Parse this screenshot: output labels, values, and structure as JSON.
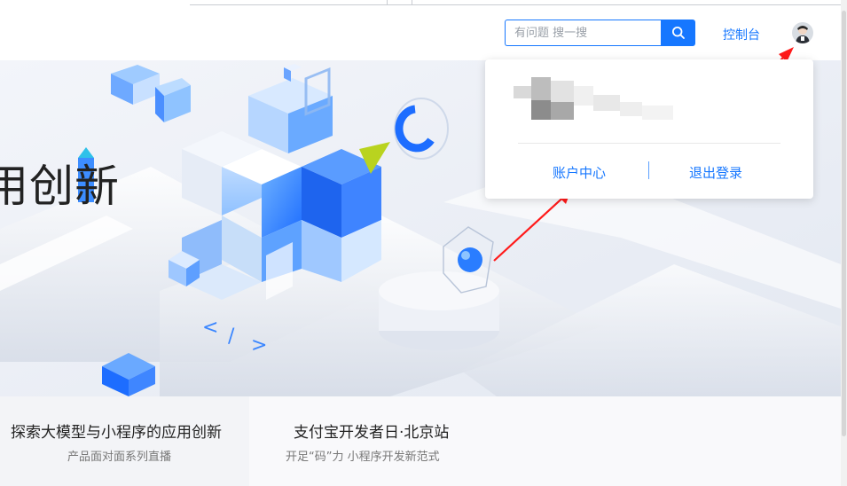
{
  "header": {
    "search_placeholder": "有问题 搜一搜",
    "console_label": "控制台"
  },
  "hero": {
    "title_fragment": "用创新"
  },
  "account_menu": {
    "account_center_label": "账户中心",
    "logout_label": "退出登录"
  },
  "cards": [
    {
      "title": "探索大模型与小程序的应用创新",
      "subtitle": "产品面对面系列直播"
    },
    {
      "title": "支付宝开发者日·北京站",
      "subtitle": "开足“码”力 小程序开发新范式"
    }
  ],
  "colors": {
    "accent": "#1677ff",
    "annotation_arrow": "#ff1a1a"
  },
  "icons": {
    "search_button": "search-icon",
    "user": "avatar"
  }
}
